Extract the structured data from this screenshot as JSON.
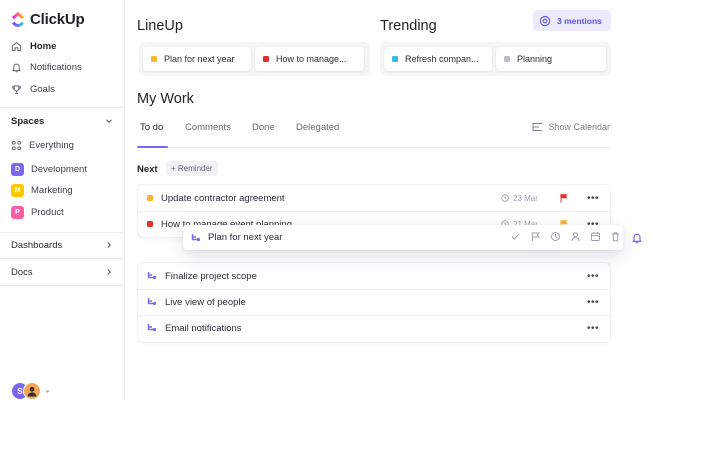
{
  "app": {
    "name": "ClickUp"
  },
  "sidebar": {
    "nav": [
      {
        "label": "Home",
        "icon": "home-icon",
        "active": true
      },
      {
        "label": "Notifications",
        "icon": "bell-icon",
        "active": false
      },
      {
        "label": "Goals",
        "icon": "trophy-icon",
        "active": false
      }
    ],
    "spaces_title": "Spaces",
    "everything": "Everything",
    "spaces": [
      {
        "label": "Development",
        "badge": "D",
        "color": "#7b68ee"
      },
      {
        "label": "Marketing",
        "badge": "M",
        "color": "#ffc800"
      },
      {
        "label": "Product",
        "badge": "P",
        "color": "#f95fa5"
      }
    ],
    "dashboards": "Dashboards",
    "docs": "Docs",
    "avatar_initial": "S"
  },
  "lineup": {
    "title": "LineUp",
    "items": [
      {
        "label": "Plan for next year",
        "color": "#f7b52b"
      },
      {
        "label": "How to manage...",
        "color": "#e0322d"
      }
    ]
  },
  "trending": {
    "title": "Trending",
    "items": [
      {
        "label": "Refresh compan...",
        "color": "#3db8f0"
      },
      {
        "label": "Planning",
        "color": "#b9bec7"
      }
    ]
  },
  "mentions": {
    "label": "3 mentions"
  },
  "my_work": {
    "title": "My Work",
    "tabs": [
      "To do",
      "Comments",
      "Done",
      "Delegated"
    ],
    "show_calendar": "Show Calendar",
    "next_label": "Next",
    "reminder_label": "+ Reminder",
    "next_tasks": [
      {
        "title": "Update contractor agreement",
        "date": "23 Mar",
        "flag_color": "#e0322d",
        "status_color": "#f7b52b"
      },
      {
        "title": "How to manage event planning",
        "date": "21 Mar",
        "flag_color": "#f7b52b",
        "status_color": "#e0322d"
      }
    ],
    "dragging_task": {
      "title": "Plan for next year"
    },
    "other_tasks": [
      {
        "title": "Finalize project scope"
      },
      {
        "title": "Live view of people"
      },
      {
        "title": "Email notifications"
      }
    ]
  },
  "colors": {
    "accent": "#7b68ee",
    "mention_bg": "#ecebfd",
    "mention_text": "#5b54e6"
  }
}
